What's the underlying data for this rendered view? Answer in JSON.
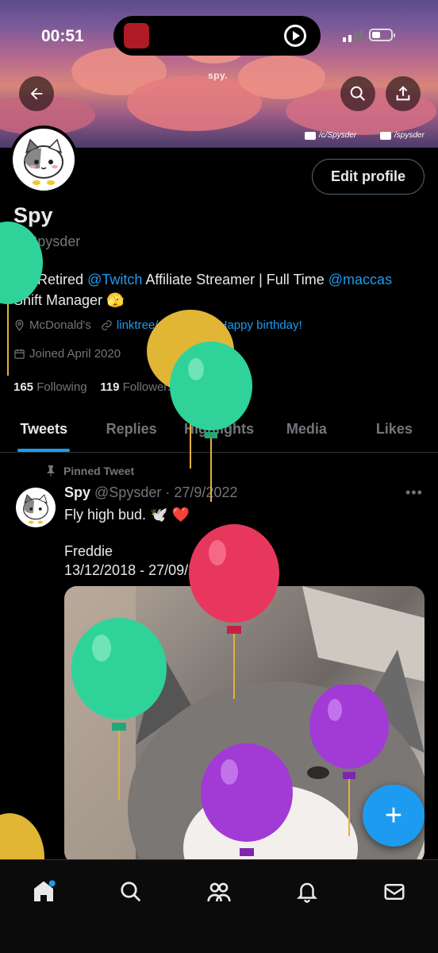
{
  "status_bar": {
    "time": "00:51"
  },
  "banner": {
    "brand": "spy.",
    "youtube_handle": "/c/Spysder",
    "twitch_handle": "/spysder"
  },
  "profile": {
    "display_name": "Spy",
    "handle": "@Spysder",
    "edit_profile_label": "Edit profile",
    "bio": {
      "part1": "18. Retired ",
      "mention1": "@Twitch",
      "part2": " Affiliate Streamer | Full Time ",
      "mention2": "@maccas",
      "part3": "Shift Manager 🫣"
    },
    "location": "McDonald's",
    "link": "linktree/pbfspy",
    "birthday": "Happy birthday!",
    "joined": "Joined April 2020",
    "following_count": "165",
    "following_label": "Following",
    "followers_count": "119",
    "followers_label": "Followers"
  },
  "tabs": [
    {
      "label": "Tweets",
      "active": true
    },
    {
      "label": "Replies",
      "active": false
    },
    {
      "label": "Highlights",
      "active": false
    },
    {
      "label": "Media",
      "active": false
    },
    {
      "label": "Likes",
      "active": false
    }
  ],
  "pinned_tweet": {
    "pinned_label": "Pinned Tweet",
    "author_name": "Spy",
    "author_handle": "@Spysder",
    "date": "· 27/9/2022",
    "more": "•••",
    "line1": "Fly high bud. 🕊️ ❤️",
    "line2": "Freddie",
    "line3": "13/12/2018 - 27/09/2022"
  },
  "fab_label": "+",
  "colors": {
    "accent": "#1d9bf0",
    "background": "#000000",
    "muted": "#71767b"
  }
}
